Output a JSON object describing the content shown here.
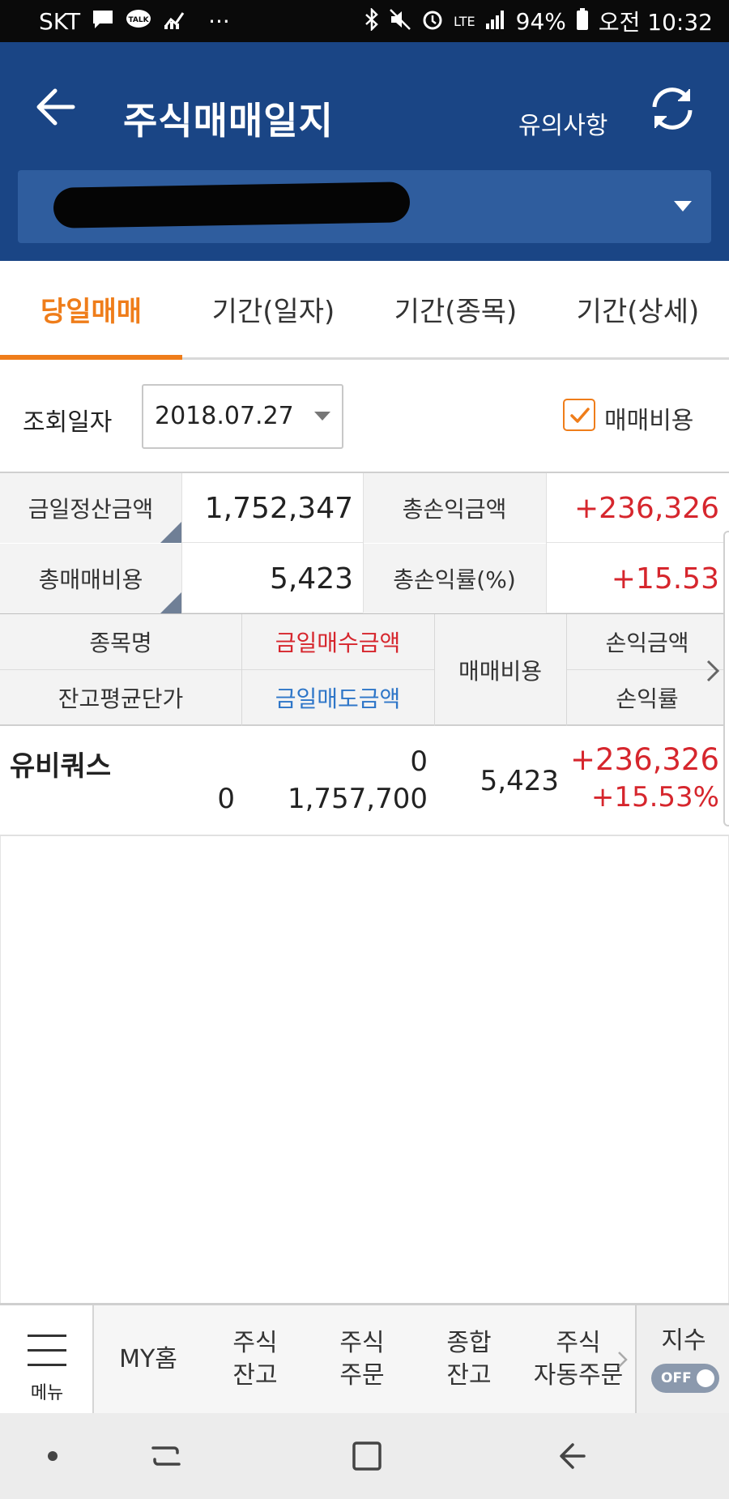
{
  "status_bar": {
    "carrier": "SKT",
    "left_icons": [
      "message-icon",
      "kakaotalk-icon",
      "stocks-app-icon",
      "more-icon"
    ],
    "kakao_badge": "TALK",
    "more": "···",
    "network": "LTE",
    "battery": "94%",
    "time": "오전 10:32"
  },
  "header": {
    "title": "주식매매일지",
    "notice_label": "유의사항",
    "account_value": "I"
  },
  "tabs": [
    {
      "label": "당일매매",
      "active": true
    },
    {
      "label": "기간(일자)",
      "active": false
    },
    {
      "label": "기간(종목)",
      "active": false
    },
    {
      "label": "기간(상세)",
      "active": false
    }
  ],
  "filter": {
    "date_label": "조회일자",
    "date_value": "2018.07.27",
    "fee_checkbox_label": "매매비용",
    "fee_checked": true
  },
  "summary": {
    "settlement_label": "금일정산금액",
    "settlement_value": "1,752,347",
    "total_pl_label": "총손익금액",
    "total_pl_value": "+236,326",
    "total_fee_label": "총매매비용",
    "total_fee_value": "5,423",
    "total_rate_label": "총손익률(%)",
    "total_rate_value": "+15.53"
  },
  "list_header": {
    "stock_name": "종목명",
    "avg_price": "잔고평균단가",
    "buy_amount": "금일매수금액",
    "sell_amount": "금일매도금액",
    "fee": "매매비용",
    "pl_amount": "손익금액",
    "pl_rate": "손익률"
  },
  "rows": [
    {
      "name": "유비쿼스",
      "avg_price": "0",
      "buy_amount": "0",
      "sell_amount": "1,757,700",
      "fee": "5,423",
      "pl_amount": "+236,326",
      "pl_rate": "+15.53%"
    }
  ],
  "bottom_nav": {
    "menu_label": "메뉴",
    "items": [
      "MY홈",
      "주식\n잔고",
      "주식\n주문",
      "종합\n잔고",
      "주식\n자동주문"
    ],
    "index_label": "지수",
    "index_toggle": "OFF"
  },
  "colors": {
    "header_bg": "#1a4585",
    "accent": "#ef7d1a",
    "profit_red": "#d6262d",
    "sell_blue": "#2e76c8"
  }
}
